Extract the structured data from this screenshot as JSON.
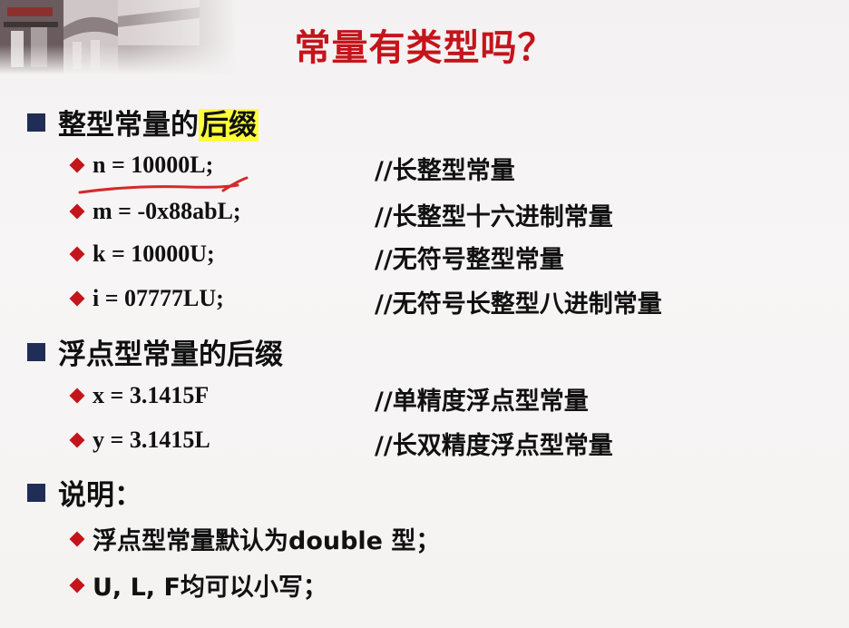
{
  "title": "常量有类型吗？",
  "sections": [
    {
      "heading_pre": "整型常量的",
      "heading_hl": "后缀",
      "items": [
        {
          "code": "n = 10000L;",
          "comment": "//长整型常量"
        },
        {
          "code": "m = -0x88abL;",
          "comment": "//长整型十六进制常量"
        },
        {
          "code": "k = 10000U;",
          "comment": "//无符号整型常量"
        },
        {
          "code": "i = 07777LU;",
          "comment": "//无符号长整型八进制常量"
        }
      ]
    },
    {
      "heading": "浮点型常量的后缀",
      "items": [
        {
          "code": "x = 3.1415F",
          "comment": "//单精度浮点型常量"
        },
        {
          "code": "y = 3.1415L",
          "comment": "//长双精度浮点型常量"
        }
      ]
    },
    {
      "heading": "说明：",
      "notes": [
        "浮点型常量默认为double 型；",
        "U, L, F均可以小写；"
      ]
    }
  ],
  "colors": {
    "title": "#c3151b",
    "bullet_square": "#1f2d57",
    "bullet_diamond": "#c3151b",
    "highlight": "#ffff3a",
    "annotation_ink": "#d42a2a"
  }
}
